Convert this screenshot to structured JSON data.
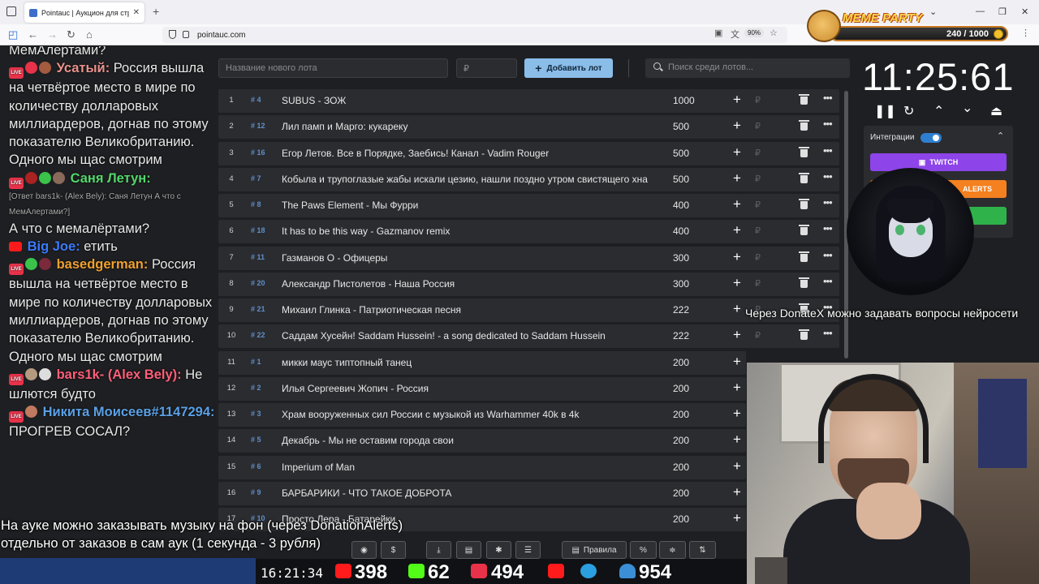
{
  "browser": {
    "tab_title": "Pointauc | Аукцион для стрим",
    "url": "pointauc.com",
    "zoom": "90%"
  },
  "meme_party": {
    "title": "MEME PARTY",
    "count": "240 / 1000"
  },
  "chat": [
    {
      "text": "МемАлертами?"
    },
    {
      "nick": "Усатый:",
      "nick_color": "#e9928c",
      "text": "Россия вышла на четвёртое место в мире по количеству долларовых миллиардеров, догнав по этому показателю Великобританию. Одного мы щас смотрим"
    },
    {
      "nick": "Саня Летун:",
      "nick_color": "#53d86a",
      "quote": "[Ответ bars1k- (Alex Bely): Саня Летун А что с МемАлертами?]",
      "text": "А что с мемалёртами?"
    },
    {
      "nick": "Big Joe:",
      "nick_color": "#3b7bff",
      "text": "етить"
    },
    {
      "nick": "basedgerman:",
      "nick_color": "#f0a12e",
      "text": "Россия вышла на четвёртое место в мире по количеству долларовых миллиардеров, догнав по этому показателю Великобританию. Одного мы щас смотрим"
    },
    {
      "nick": "bars1k- (Alex Bely):",
      "nick_color": "#ff5f7a",
      "text": "Не шлются будто"
    },
    {
      "nick": "Никита Моисеев#1147294:",
      "nick_color": "#5aa0e6",
      "text": "ПРОГРЕВ СОСАЛ?"
    }
  ],
  "controls": {
    "new_lot_placeholder": "Название нового лота",
    "price_placeholder": "₽",
    "add_button": "Добавить лот",
    "search_placeholder": "Поиск среди лотов..."
  },
  "lots": [
    {
      "n": "1",
      "id": "# 4",
      "name": "SUBUS - ЗОЖ",
      "amount": "1000"
    },
    {
      "n": "2",
      "id": "# 12",
      "name": "Лил памп и Марго: кукареку",
      "amount": "500"
    },
    {
      "n": "3",
      "id": "# 16",
      "name": "Егор Летов. Все в Порядке, Заебись! Канал - Vadim Rouger",
      "amount": "500"
    },
    {
      "n": "4",
      "id": "# 7",
      "name": "Кобыла и трупоглазые жабы искали цезию, нашли поздно утром свистящего хна",
      "amount": "500"
    },
    {
      "n": "5",
      "id": "# 8",
      "name": "The Paws Element - Мы Фурри",
      "amount": "400"
    },
    {
      "n": "6",
      "id": "# 18",
      "name": "It has to be this way - Gazmanov remix",
      "amount": "400"
    },
    {
      "n": "7",
      "id": "# 11",
      "name": "Газманов О - Офицеры",
      "amount": "300"
    },
    {
      "n": "8",
      "id": "# 20",
      "name": "Александр Пистолетов - Наша Россия",
      "amount": "300"
    },
    {
      "n": "9",
      "id": "# 21",
      "name": "Михаил Глинка - Патриотическая песня",
      "amount": "222"
    },
    {
      "n": "10",
      "id": "# 22",
      "name": "Саддам Хусейн! Saddam Hussein! - a song dedicated to Saddam Hussein",
      "amount": "222"
    },
    {
      "n": "11",
      "id": "# 1",
      "name": "микки маус типтопный танец",
      "amount": "200"
    },
    {
      "n": "12",
      "id": "# 2",
      "name": "Илья Сергеевич Жопич - Россия",
      "amount": "200"
    },
    {
      "n": "13",
      "id": "# 3",
      "name": "Храм вооруженных сил России с музыкой из Warhammer 40k в 4k",
      "amount": "200"
    },
    {
      "n": "14",
      "id": "# 5",
      "name": "Декабрь - Мы не оставим города свои",
      "amount": "200"
    },
    {
      "n": "15",
      "id": "# 6",
      "name": "Imperium of Man",
      "amount": "200"
    },
    {
      "n": "16",
      "id": "# 9",
      "name": "БАРБАРИКИ - ЧТО ТАКОЕ ДОБРОТА",
      "amount": "200"
    },
    {
      "n": "17",
      "id": "# 10",
      "name": "Просто Лера - Батарейки",
      "amount": "200"
    }
  ],
  "bottom_bar": {
    "rules": "Правила",
    "percent": "%"
  },
  "timer": "11:25:61",
  "integrations": {
    "label": "Интеграции",
    "twitch": "TWITCH",
    "alerts": "ALERTS"
  },
  "caption": "Через DonateX можно задавать вопросы нейросети",
  "stream": {
    "clock": "16:21:34",
    "youtube": "398",
    "kick": "62",
    "live": "494",
    "telegram": "954"
  },
  "subtitle": [
    "На ауке можно заказывать музыку на фон (через DonationAlerts)",
    "отдельно от заказов в сам аук (1 секунда - 3 рубля)"
  ]
}
